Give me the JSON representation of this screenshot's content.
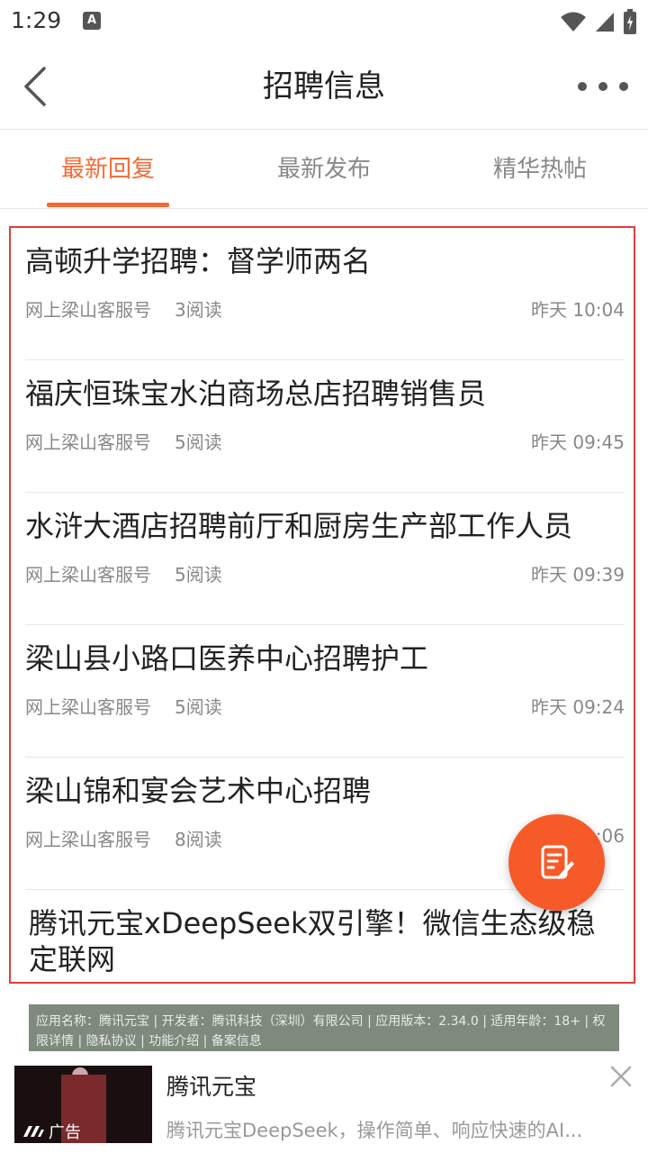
{
  "status_bar": {
    "time": "1:29",
    "notification_letter": "A"
  },
  "header": {
    "title": "招聘信息"
  },
  "tabs": [
    {
      "label": "最新回复",
      "active": true
    },
    {
      "label": "最新发布",
      "active": false
    },
    {
      "label": "精华热帖",
      "active": false
    }
  ],
  "posts": [
    {
      "title": "高顿升学招聘：督学师两名",
      "author": "网上梁山客服号",
      "reads": "3阅读",
      "time": "昨天 10:04"
    },
    {
      "title": "福庆恒珠宝水泊商场总店招聘销售员",
      "author": "网上梁山客服号",
      "reads": "5阅读",
      "time": "昨天 09:45"
    },
    {
      "title": "水浒大酒店招聘前厅和厨房生产部工作人员",
      "author": "网上梁山客服号",
      "reads": "5阅读",
      "time": "昨天 09:39"
    },
    {
      "title": "梁山县小路口医养中心招聘护工",
      "author": "网上梁山客服号",
      "reads": "5阅读",
      "time": "昨天 09:24"
    },
    {
      "title": "梁山锦和宴会艺术中心招聘",
      "author": "网上梁山客服号",
      "reads": "8阅读",
      "time": "1:06"
    }
  ],
  "ad_post": {
    "title": "腾讯元宝xDeepSeek双引擎！微信生态级稳定联网"
  },
  "bottom_ad": {
    "info": "应用名称：腾讯元宝 | 开发者：腾讯科技（深圳）有限公司 | 应用版本：2.34.0 | 适用年龄：18+ | 权限详情 | 隐私协议 | 功能介绍 | 备案信息",
    "badge": "广告",
    "app_name": "腾讯元宝",
    "description": "腾讯元宝DeepSeek，操作简单、响应快速的AI..."
  },
  "colors": {
    "accent": "#f46a32",
    "fab": "#f65a28",
    "highlight_border": "#e03c3c"
  },
  "icons": [
    "back-arrow-icon",
    "more-dots-icon",
    "edit-note-icon",
    "close-icon",
    "wifi-icon",
    "signal-icon",
    "battery-icon"
  ]
}
